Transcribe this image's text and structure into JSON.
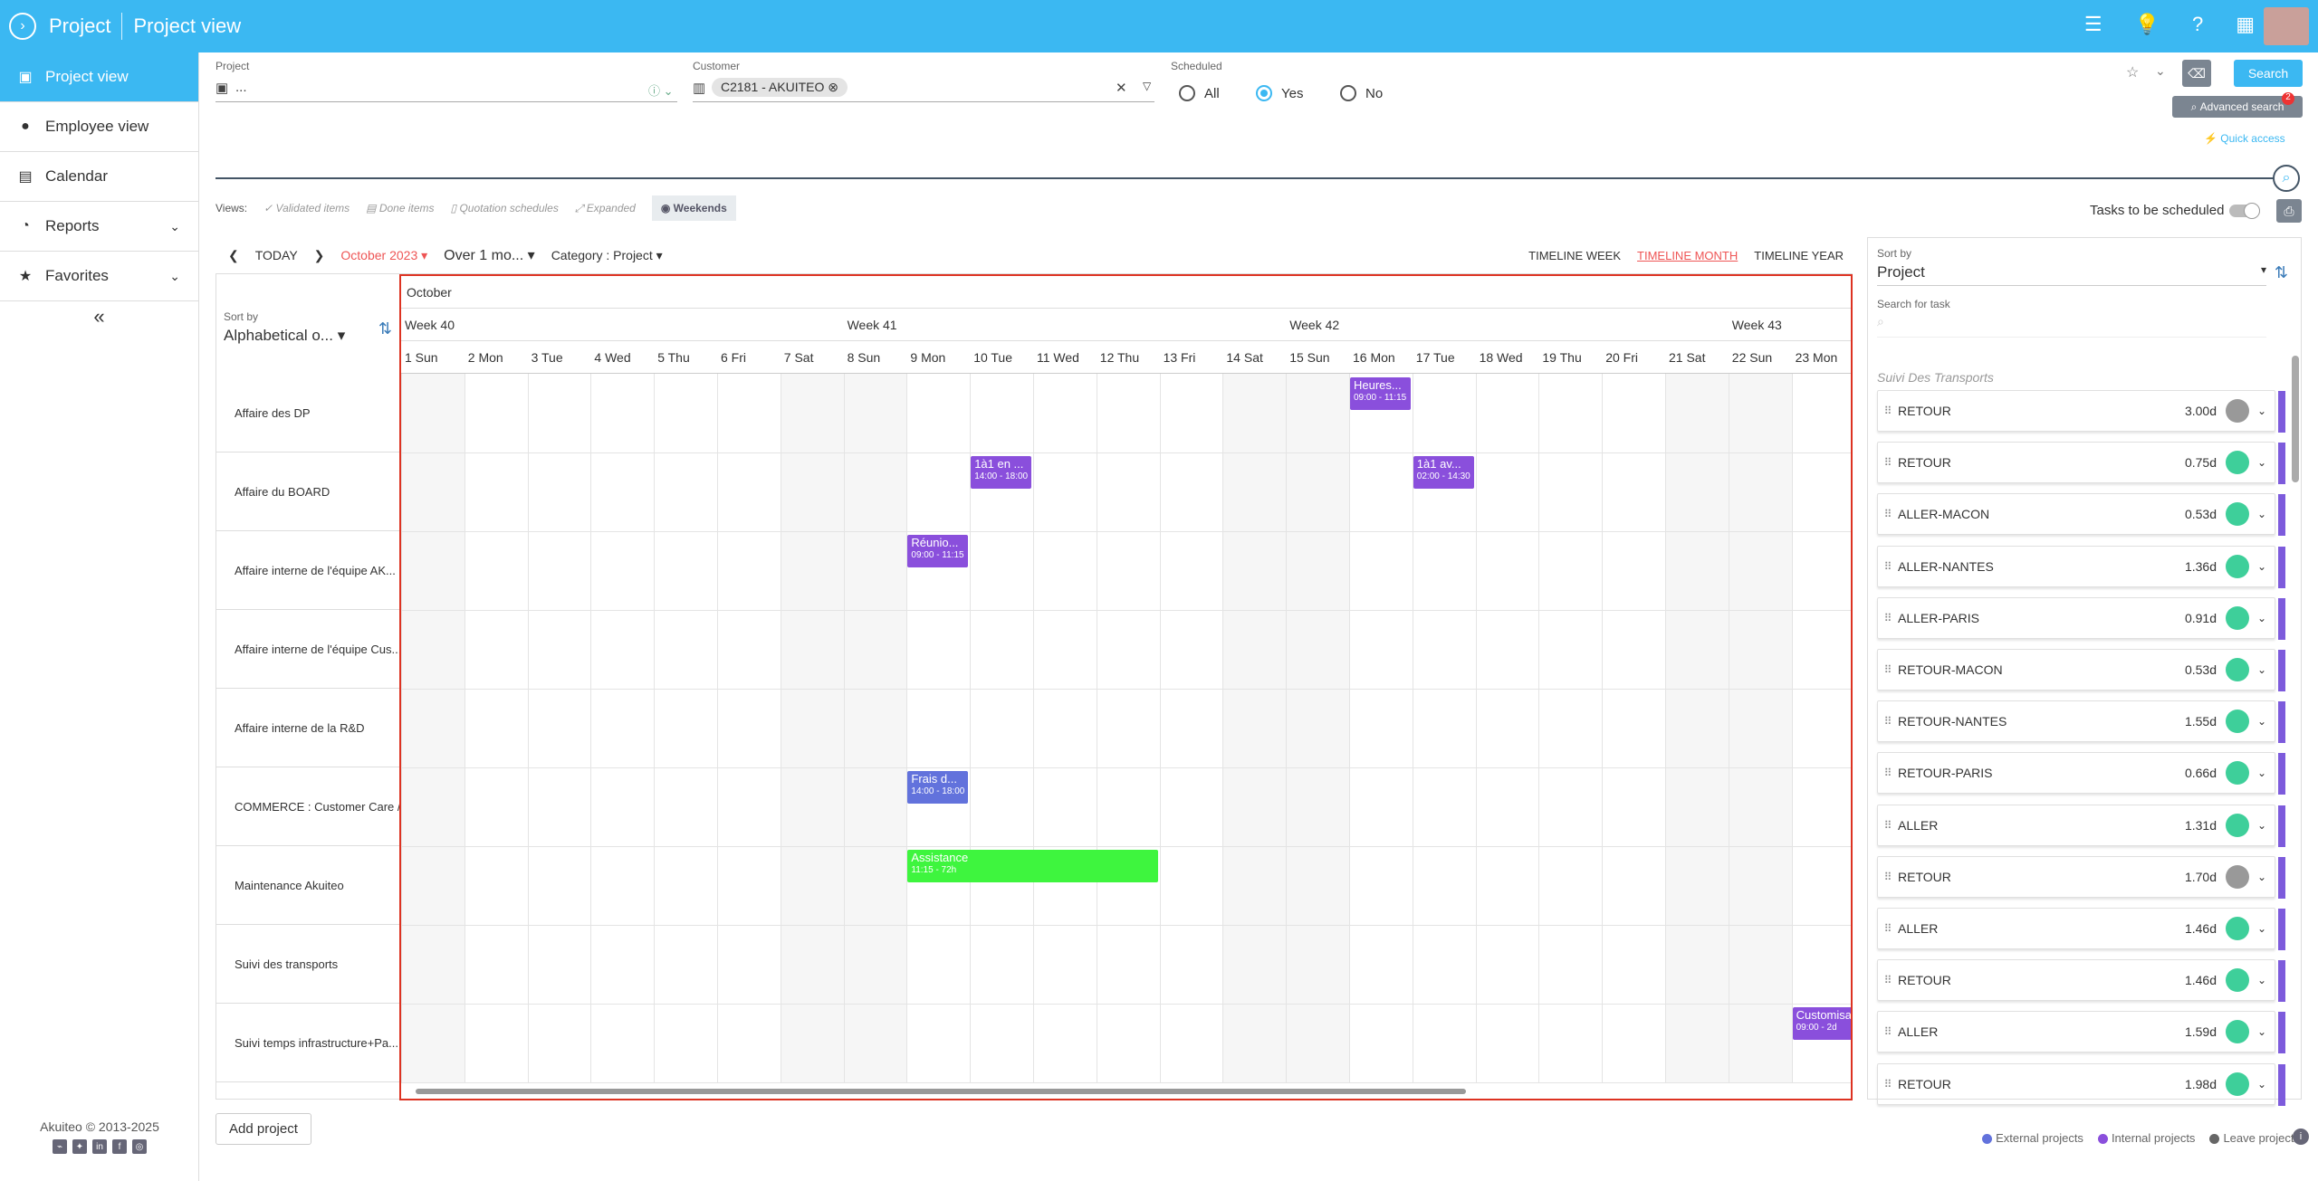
{
  "header": {
    "app_title": "Project",
    "page_title": "Project view"
  },
  "sidebar": {
    "items": [
      {
        "label": "Project view",
        "icon": "briefcase-icon"
      },
      {
        "label": "Employee view",
        "icon": "user-icon"
      },
      {
        "label": "Calendar",
        "icon": "calendar-icon"
      },
      {
        "label": "Reports",
        "icon": "reports-icon"
      },
      {
        "label": "Favorites",
        "icon": "star-icon"
      }
    ],
    "footer": "Akuiteo © 2013-2025"
  },
  "filters": {
    "project_label": "Project",
    "project_value": "...",
    "customer_label": "Customer",
    "customer_chip": "C2181 - AKUITEO",
    "scheduled_label": "Scheduled",
    "scheduled_options": [
      "All",
      "Yes",
      "No"
    ],
    "scheduled_selected": "Yes",
    "search_label": "Search",
    "advanced_search_label": "Advanced search",
    "advanced_search_badge": "2",
    "quick_access_label": "Quick access"
  },
  "views": {
    "label": "Views:",
    "items": [
      "Validated items",
      "Done items",
      "Quotation schedules",
      "Expanded",
      "Weekends"
    ],
    "tasks_toggle_label": "Tasks to be scheduled"
  },
  "toolbar": {
    "today": "TODAY",
    "period": "October 2023",
    "range": "Over 1 mo...",
    "category": "Category : Project",
    "timeline_week": "TIMELINE WEEK",
    "timeline_month": "TIMELINE MONTH",
    "timeline_year": "TIMELINE YEAR"
  },
  "schedule": {
    "sort_label": "Sort by",
    "sort_value": "Alphabetical o...",
    "month": "October",
    "weeks": [
      "Week 40",
      "Week 41",
      "Week 42",
      "Week 43"
    ],
    "days": [
      "1 Sun",
      "2 Mon",
      "3 Tue",
      "4 Wed",
      "5 Thu",
      "6 Fri",
      "7 Sat",
      "8 Sun",
      "9 Mon",
      "10 Tue",
      "11 Wed",
      "12 Thu",
      "13 Fri",
      "14 Sat",
      "15 Sun",
      "16 Mon",
      "17 Tue",
      "18 Wed",
      "19 Thu",
      "20 Fri",
      "21 Sat",
      "22 Sun",
      "23 Mon"
    ],
    "rows": [
      "Affaire des DP",
      "Affaire du BOARD",
      "Affaire interne de l'équipe AK...",
      "Affaire interne de l'équipe Cus...",
      "Affaire interne de la R&D",
      "COMMERCE : Customer Care /...",
      "Maintenance Akuiteo",
      "Suivi des transports",
      "Suivi temps infrastructure+Pa..."
    ],
    "events": [
      {
        "title": "Heures...",
        "time": "09:00 - 11:15",
        "color": "#8a4fdc",
        "row": 0,
        "day": 15,
        "span": 1
      },
      {
        "title": "1à1 en ...",
        "time": "14:00 - 18:00",
        "color": "#8a4fdc",
        "row": 1,
        "day": 9,
        "span": 1
      },
      {
        "title": "1à1 av...",
        "time": "02:00 - 14:30",
        "color": "#8a4fdc",
        "row": 1,
        "day": 16,
        "span": 1
      },
      {
        "title": "Réunio...",
        "time": "09:00 - 11:15",
        "color": "#8a4fdc",
        "row": 2,
        "day": 8,
        "span": 1
      },
      {
        "title": "Frais d...",
        "time": "14:00 - 18:00",
        "color": "#6272dc",
        "row": 5,
        "day": 8,
        "span": 1
      },
      {
        "title": "Assistance",
        "time": "11:15 - 72h",
        "color": "#3ef53e",
        "row": 6,
        "day": 8,
        "span": 4
      },
      {
        "title": "Customisa...",
        "time": "09:00 - 2d",
        "color": "#8a4fdc",
        "row": 8,
        "day": 22,
        "span": 1
      }
    ]
  },
  "tasks_panel": {
    "sort_label": "Sort by",
    "sort_value": "Project",
    "search_label": "Search for task",
    "group": "Suivi Des Transports",
    "tasks": [
      {
        "label": "RETOUR",
        "duration": "3.00d",
        "status": "#999999"
      },
      {
        "label": "RETOUR",
        "duration": "0.75d",
        "status": "#3ecf9a"
      },
      {
        "label": "ALLER-MACON",
        "duration": "0.53d",
        "status": "#3ecf9a"
      },
      {
        "label": "ALLER-NANTES",
        "duration": "1.36d",
        "status": "#3ecf9a"
      },
      {
        "label": "ALLER-PARIS",
        "duration": "0.91d",
        "status": "#3ecf9a"
      },
      {
        "label": "RETOUR-MACON",
        "duration": "0.53d",
        "status": "#3ecf9a"
      },
      {
        "label": "RETOUR-NANTES",
        "duration": "1.55d",
        "status": "#3ecf9a"
      },
      {
        "label": "RETOUR-PARIS",
        "duration": "0.66d",
        "status": "#3ecf9a"
      },
      {
        "label": "ALLER",
        "duration": "1.31d",
        "status": "#3ecf9a"
      },
      {
        "label": "RETOUR",
        "duration": "1.70d",
        "status": "#999999"
      },
      {
        "label": "ALLER",
        "duration": "1.46d",
        "status": "#3ecf9a"
      },
      {
        "label": "RETOUR",
        "duration": "1.46d",
        "status": "#3ecf9a"
      },
      {
        "label": "ALLER",
        "duration": "1.59d",
        "status": "#3ecf9a"
      },
      {
        "label": "RETOUR",
        "duration": "1.98d",
        "status": "#3ecf9a"
      }
    ]
  },
  "legend": [
    {
      "label": "External projects",
      "color": "#6272dc"
    },
    {
      "label": "Internal projects",
      "color": "#8a4fdc"
    },
    {
      "label": "Leave projects",
      "color": "#666666"
    }
  ],
  "add_project_label": "Add project"
}
